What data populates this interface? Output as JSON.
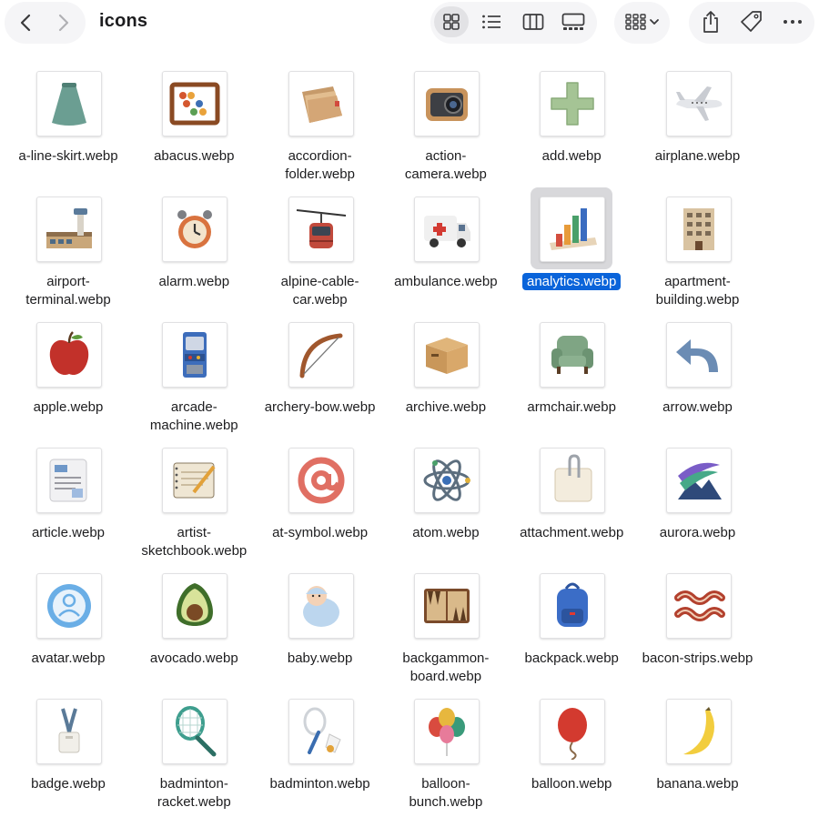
{
  "window": {
    "title": "icons"
  },
  "toolbar": {
    "back": "back",
    "forward": "forward",
    "views": [
      "icon-view",
      "list-view",
      "column-view",
      "gallery-view"
    ],
    "active_view": "icon-view",
    "group_by": "group-by",
    "share": "share",
    "tags": "tags",
    "more": "more"
  },
  "files": [
    {
      "label": "a-line-skirt.webp",
      "icon": "skirt-icon"
    },
    {
      "label": "abacus.webp",
      "icon": "abacus-icon"
    },
    {
      "label": "accordion-folder.webp",
      "icon": "accordion-folder-icon"
    },
    {
      "label": "action-camera.webp",
      "icon": "action-camera-icon"
    },
    {
      "label": "add.webp",
      "icon": "plus-icon"
    },
    {
      "label": "airplane.webp",
      "icon": "airplane-icon"
    },
    {
      "label": "airport-terminal.webp",
      "icon": "airport-terminal-icon"
    },
    {
      "label": "alarm.webp",
      "icon": "alarm-clock-icon"
    },
    {
      "label": "alpine-cable-car.webp",
      "icon": "cable-car-icon"
    },
    {
      "label": "ambulance.webp",
      "icon": "ambulance-icon"
    },
    {
      "label": "analytics.webp",
      "icon": "bar-chart-icon",
      "selected": true
    },
    {
      "label": "apartment-building.webp",
      "icon": "building-icon"
    },
    {
      "label": "apple.webp",
      "icon": "apple-icon"
    },
    {
      "label": "arcade-machine.webp",
      "icon": "arcade-machine-icon"
    },
    {
      "label": "archery-bow.webp",
      "icon": "bow-icon"
    },
    {
      "label": "archive.webp",
      "icon": "archive-box-icon"
    },
    {
      "label": "armchair.webp",
      "icon": "armchair-icon"
    },
    {
      "label": "arrow.webp",
      "icon": "curved-arrow-icon"
    },
    {
      "label": "article.webp",
      "icon": "article-icon"
    },
    {
      "label": "artist-sketchbook.webp",
      "icon": "sketchbook-icon"
    },
    {
      "label": "at-symbol.webp",
      "icon": "at-symbol-icon"
    },
    {
      "label": "atom.webp",
      "icon": "atom-icon"
    },
    {
      "label": "attachment.webp",
      "icon": "paperclip-note-icon"
    },
    {
      "label": "aurora.webp",
      "icon": "aurora-icon"
    },
    {
      "label": "avatar.webp",
      "icon": "avatar-icon"
    },
    {
      "label": "avocado.webp",
      "icon": "avocado-icon"
    },
    {
      "label": "baby.webp",
      "icon": "baby-icon"
    },
    {
      "label": "backgammon-board.webp",
      "icon": "backgammon-icon"
    },
    {
      "label": "backpack.webp",
      "icon": "backpack-icon"
    },
    {
      "label": "bacon-strips.webp",
      "icon": "bacon-icon"
    },
    {
      "label": "badge.webp",
      "icon": "lanyard-badge-icon"
    },
    {
      "label": "badminton-racket.webp",
      "icon": "racket-icon"
    },
    {
      "label": "badminton.webp",
      "icon": "shuttlecock-icon"
    },
    {
      "label": "balloon-bunch.webp",
      "icon": "balloon-bunch-icon"
    },
    {
      "label": "balloon.webp",
      "icon": "balloon-icon"
    },
    {
      "label": "banana.webp",
      "icon": "banana-icon"
    }
  ],
  "colors": {
    "selection": "#0a64da",
    "selection_bg": "#d8d8db",
    "toolbar_pill": "#f5f5f7"
  }
}
